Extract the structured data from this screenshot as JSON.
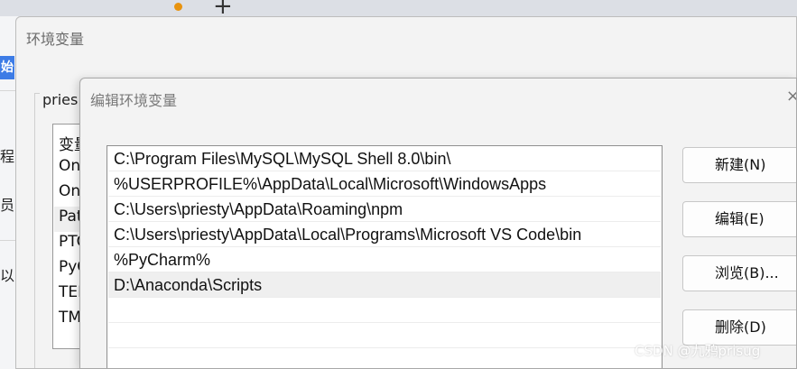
{
  "browser": {
    "plus_label": "+"
  },
  "background_app": {
    "start_label": "始",
    "texts": [
      "程",
      "员",
      "以"
    ]
  },
  "env_window": {
    "title": "环境变量",
    "group_label": "pries",
    "rows": [
      "变量",
      "On",
      "On",
      "Pat",
      "PTC",
      "PyC",
      "TEI",
      "TM"
    ]
  },
  "edit_dialog": {
    "title": "编辑环境变量",
    "close_glyph": "×",
    "paths": [
      "C:\\Program Files\\MySQL\\MySQL Shell 8.0\\bin\\",
      "%USERPROFILE%\\AppData\\Local\\Microsoft\\WindowsApps",
      "C:\\Users\\priesty\\AppData\\Roaming\\npm",
      "C:\\Users\\priesty\\AppData\\Local\\Programs\\Microsoft VS Code\\bin",
      "%PyCharm%",
      "D:\\Anaconda\\Scripts",
      "",
      "",
      ""
    ],
    "buttons": {
      "new": "新建(N)",
      "edit": "编辑(E)",
      "browse": "浏览(B)...",
      "delete": "删除(D)"
    }
  },
  "watermark": "CSDN @九鸦prisug",
  "colors": {
    "accent_dot": "#e8930f",
    "start_blue": "#3d7ce6",
    "selection": "#efefef"
  }
}
